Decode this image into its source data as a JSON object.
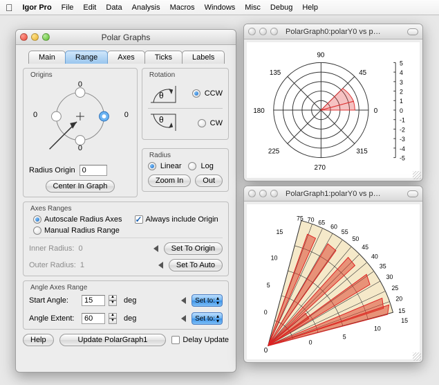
{
  "menubar": {
    "app": "Igor Pro",
    "items": [
      "File",
      "Edit",
      "Data",
      "Analysis",
      "Macros",
      "Windows",
      "Misc",
      "Debug",
      "Help"
    ]
  },
  "panelWindow": {
    "title": "Polar Graphs",
    "tabs": [
      "Main",
      "Range",
      "Axes",
      "Ticks",
      "Labels"
    ],
    "origins": {
      "title": "Origins",
      "degrees": {
        "top": "0",
        "right": "0",
        "bottom": "0",
        "left": "0"
      },
      "radius_label": "Radius Origin",
      "radius_value": "0",
      "center_btn": "Center In Graph"
    },
    "rotation": {
      "title": "Rotation",
      "ccw": "CCW",
      "cw": "CW"
    },
    "radius": {
      "title": "Radius",
      "linear": "Linear",
      "log": "Log",
      "zoomin": "Zoom In",
      "out": "Out"
    },
    "axes": {
      "title": "Axes Ranges",
      "autoscale": "Autoscale Radius Axes",
      "always_origin": "Always include Origin",
      "manual": "Manual Radius Range",
      "inner_label": "Inner Radius:",
      "inner_value": "0",
      "outer_label": "Outer Radius:",
      "outer_value": "1",
      "set_to_origin": "Set To Origin",
      "set_to_auto": "Set To Auto"
    },
    "angle": {
      "title": "Angle Axes Range",
      "start_label": "Start Angle:",
      "start_value": "15",
      "extent_label": "Angle Extent:",
      "extent_value": "60",
      "deg": "deg",
      "setto": "Set to:"
    },
    "footer": {
      "help": "Help",
      "update": "Update PolarGraph1",
      "delay": "Delay Update"
    }
  },
  "graph0": {
    "title": "PolarGraph0:polarY0 vs po...",
    "angles": [
      "0",
      "45",
      "90",
      "135",
      "180",
      "225",
      "270",
      "315"
    ],
    "scale": [
      "5",
      "4",
      "3",
      "2",
      "1",
      "0",
      "-1",
      "-2",
      "-3",
      "-4",
      "-5"
    ]
  },
  "graph1": {
    "title": "PolarGraph1:polarY0 vs po...",
    "ticks": [
      "0",
      "5",
      "10",
      "15",
      "20",
      "25",
      "30",
      "35",
      "40",
      "45",
      "50",
      "55",
      "60",
      "65",
      "70",
      "75"
    ],
    "origin": "0"
  }
}
